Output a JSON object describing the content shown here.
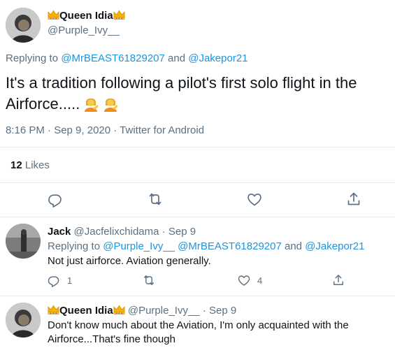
{
  "main_tweet": {
    "display_name": "Queen Idia",
    "handle": "@Purple_Ivy__",
    "replying_to_label": "Replying to",
    "replying_to_user1": "@MrBEAST61829207",
    "replying_and": "and",
    "replying_to_user2": "@Jakepor21",
    "text": "It's a tradition following a pilot's first solo flight in the Airforce.....",
    "meta": "8:16 PM · Sep 9, 2020 · Twitter for Android",
    "likes_count": "12",
    "likes_label": "Likes"
  },
  "reply1": {
    "display_name": "Jack",
    "handle": "@Jacfelixchidama",
    "dot": "·",
    "date": "Sep 9",
    "replying_to_label": "Replying to",
    "replying_to_user1": "@Purple_Ivy__",
    "replying_to_user2": "@MrBEAST61829207",
    "replying_and": "and",
    "replying_to_user3": "@Jakepor21",
    "text": "Not just airforce. Aviation generally.",
    "reply_count": "1",
    "like_count": "4"
  },
  "reply2": {
    "display_name": "Queen Idia",
    "handle": "@Purple_Ivy__",
    "dot": "·",
    "date": "Sep 9",
    "text_line1": "Don't know much about the Aviation, I'm only acquainted with the",
    "text_line2": "Airforce...That's fine though"
  },
  "colors": {
    "link": "#1b95e0",
    "muted": "#5b7083",
    "divider": "#e6ecf0",
    "text": "#0f1419"
  },
  "icons": [
    "crown-emoji-icon",
    "person-tipping-hand-emoji-icon",
    "reply-icon",
    "retweet-icon",
    "like-icon",
    "share-icon"
  ]
}
